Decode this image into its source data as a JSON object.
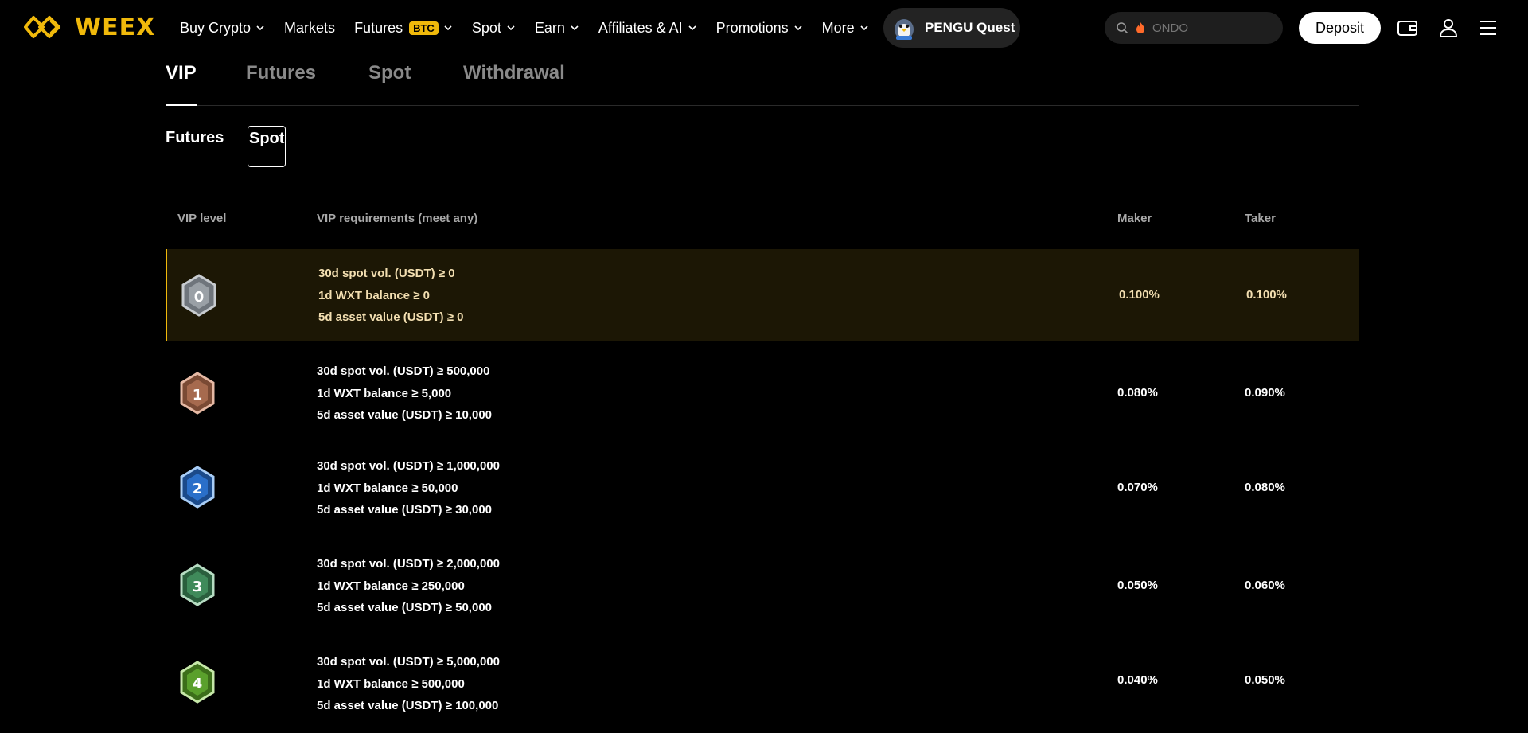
{
  "brand": {
    "name": "WEEX",
    "accent": "#f0b90b"
  },
  "nav": {
    "items": [
      {
        "label": "Buy Crypto",
        "dropdown": true
      },
      {
        "label": "Markets",
        "dropdown": false
      },
      {
        "label": "Futures",
        "badge": "BTC",
        "dropdown": true
      },
      {
        "label": "Spot",
        "dropdown": true
      },
      {
        "label": "Earn",
        "dropdown": true
      },
      {
        "label": "Affiliates & AI",
        "dropdown": true
      },
      {
        "label": "Promotions",
        "dropdown": true
      },
      {
        "label": "More",
        "dropdown": true
      }
    ],
    "quest_label": "PENGU Quest",
    "search_placeholder": "ONDO",
    "deposit_label": "Deposit",
    "icons": [
      "wallet-icon",
      "user-icon",
      "menu-icon"
    ]
  },
  "tabs": [
    {
      "label": "VIP",
      "active": true
    },
    {
      "label": "Futures",
      "active": false
    },
    {
      "label": "Spot",
      "active": false
    },
    {
      "label": "Withdrawal",
      "active": false
    }
  ],
  "subtabs": [
    {
      "label": "Futures",
      "active": false
    },
    {
      "label": "Spot",
      "active": true
    }
  ],
  "table": {
    "headers": {
      "level": "VIP level",
      "requirements": "VIP requirements (meet any)",
      "maker": "Maker",
      "taker": "Taker"
    },
    "rows": [
      {
        "level": "0",
        "color": "#9aa0a6",
        "current": true,
        "req": [
          "30d spot vol. (USDT) ≥ 0",
          "1d WXT balance ≥ 0",
          "5d asset value (USDT) ≥ 0"
        ],
        "maker": "0.100%",
        "taker": "0.100%"
      },
      {
        "level": "1",
        "color": "#a66a4e",
        "current": false,
        "req": [
          "30d spot vol. (USDT) ≥ 500,000",
          "1d WXT balance ≥ 5,000",
          "5d asset value (USDT) ≥ 10,000"
        ],
        "maker": "0.080%",
        "taker": "0.090%"
      },
      {
        "level": "2",
        "color": "#2a6fc9",
        "current": false,
        "req": [
          "30d spot vol. (USDT) ≥ 1,000,000",
          "1d WXT balance ≥ 50,000",
          "5d asset value (USDT) ≥ 30,000"
        ],
        "maker": "0.070%",
        "taker": "0.080%"
      },
      {
        "level": "3",
        "color": "#3f8a5a",
        "current": false,
        "req": [
          "30d spot vol. (USDT) ≥ 2,000,000",
          "1d WXT balance ≥ 250,000",
          "5d asset value (USDT) ≥ 50,000"
        ],
        "maker": "0.050%",
        "taker": "0.060%"
      },
      {
        "level": "4",
        "color": "#5aa02c",
        "current": false,
        "req": [
          "30d spot vol. (USDT) ≥ 5,000,000",
          "1d WXT balance ≥ 500,000",
          "5d asset value (USDT) ≥ 100,000"
        ],
        "maker": "0.040%",
        "taker": "0.050%"
      }
    ]
  }
}
